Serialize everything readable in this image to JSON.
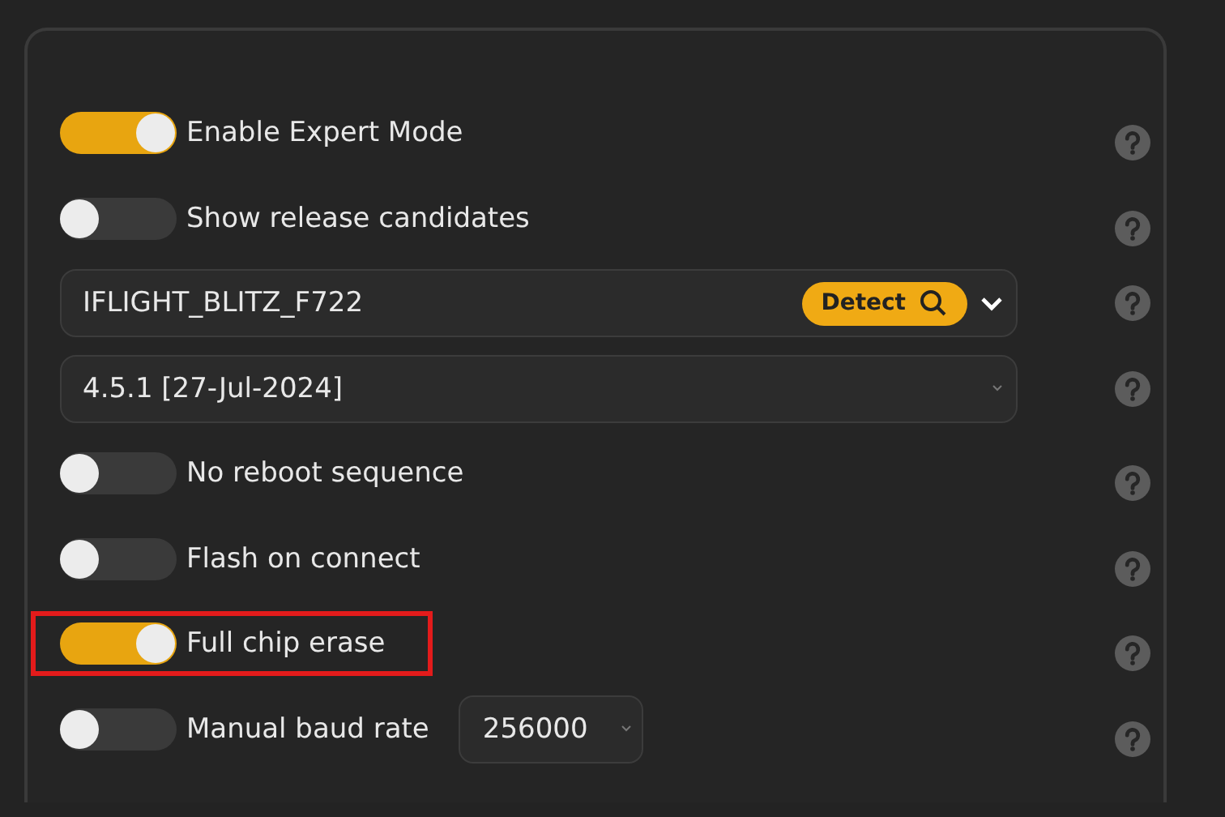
{
  "options": [
    {
      "kind": "toggle",
      "label": "Enable Expert Mode",
      "on": true,
      "highlighted": false
    },
    {
      "kind": "toggle",
      "label": "Show release candidates",
      "on": false,
      "highlighted": false
    },
    {
      "kind": "board",
      "value": "IFLIGHT_BLITZ_F722",
      "button": "Detect"
    },
    {
      "kind": "version",
      "value": "4.5.1 [27-Jul-2024]"
    },
    {
      "kind": "toggle",
      "label": "No reboot sequence",
      "on": false,
      "highlighted": false
    },
    {
      "kind": "toggle",
      "label": "Flash on connect",
      "on": false,
      "highlighted": false
    },
    {
      "kind": "toggle",
      "label": "Full chip erase",
      "on": true,
      "highlighted": true
    },
    {
      "kind": "baud",
      "label": "Manual baud rate",
      "on": false,
      "value": "256000"
    }
  ]
}
